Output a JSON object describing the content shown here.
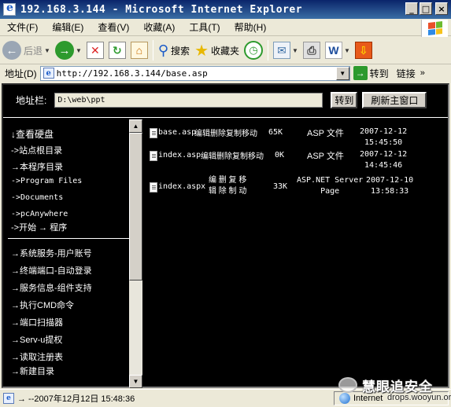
{
  "window": {
    "title": "192.168.3.144 - Microsoft Internet Explorer",
    "controls": [
      "_",
      "□",
      "×"
    ]
  },
  "menu": [
    "文件(F)",
    "编辑(E)",
    "查看(V)",
    "收藏(A)",
    "工具(T)",
    "帮助(H)"
  ],
  "toolbar": {
    "back": "后退",
    "search": "搜索",
    "favorites": "收藏夹"
  },
  "address": {
    "label": "地址(D)",
    "url": "http://192.168.3.144/base.asp",
    "go": "转到",
    "links": "链接",
    "links_chevron": "»"
  },
  "form": {
    "label": "地址栏:",
    "path": "D:\\web\\ppt",
    "go_button": "转到",
    "refresh_button": "刷新主窗口"
  },
  "left_menu": {
    "group1": [
      "↓查看硬盘",
      "->站点根目录",
      "→本程序目录",
      "->Program Files",
      "->Documents",
      "->pcAnywhere",
      "->开始 → 程序"
    ],
    "group2": [
      "→系统服务-用户账号",
      "→终端端口-自动登录",
      "→服务信息-组件支持",
      "→执行CMD命令",
      "→端口扫描器",
      "→Serv-u提权",
      "→读取注册表",
      "→新建目录"
    ]
  },
  "files": [
    {
      "name": "base.asp",
      "actions": "编辑删除复制移动",
      "size": "65K",
      "type": "ASP 文件",
      "date": "2007-12-12",
      "time": "15:45:50"
    },
    {
      "name": "index.asp",
      "actions": "编辑删除复制移动",
      "size": "0K",
      "type": "ASP 文件",
      "date": "2007-12-12",
      "time": "14:45:46"
    },
    {
      "name": "index.aspx",
      "actions_line1": "编 删 复 移",
      "actions_line2": "辑 除 制 动",
      "size": "33K",
      "type_line1": "ASP.NET Server",
      "type_line2": "Page",
      "date": "2007-12-10",
      "time": "13:58:33"
    }
  ],
  "status": {
    "text": "→  --2007年12月12日 15:48:36",
    "zone": "Internet"
  },
  "watermark": {
    "title": "慧眼追安全",
    "url": "drops.wooyun.org"
  },
  "colors": {
    "title_bar": "#0a246a",
    "page_bg": "#000000",
    "chrome": "#ece9d8"
  }
}
